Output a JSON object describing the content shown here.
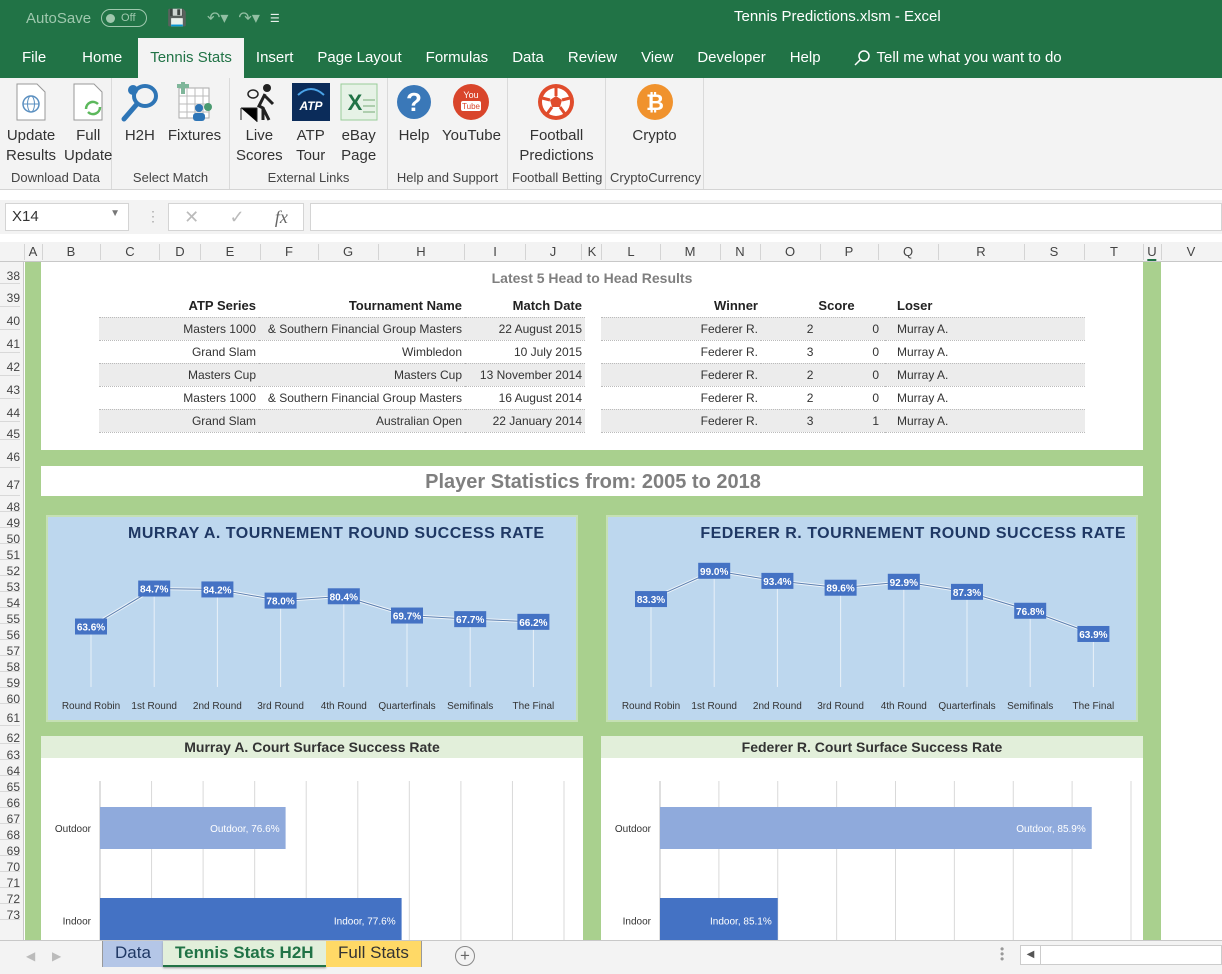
{
  "titlebar": {
    "autosave_label": "AutoSave",
    "autosave_state": "Off",
    "window_title": "Tennis Predictions.xlsm  -  Excel"
  },
  "menu_tabs": [
    "File",
    "Home",
    "Tennis Stats",
    "Insert",
    "Page Layout",
    "Formulas",
    "Data",
    "Review",
    "View",
    "Developer",
    "Help"
  ],
  "active_tab": "Tennis Stats",
  "tell_me": "Tell me what you want to do",
  "ribbon": {
    "groups": [
      {
        "label": "Download Data",
        "buttons": [
          {
            "label1": "Update",
            "label2": "Results",
            "icon": "globe-document-icon"
          },
          {
            "label1": "Full",
            "label2": "Update",
            "icon": "refresh-document-icon"
          }
        ]
      },
      {
        "label": "Select Match",
        "buttons": [
          {
            "label1": "H2H",
            "label2": "",
            "icon": "tennis-racket-icon"
          },
          {
            "label1": "Fixtures",
            "label2": "",
            "icon": "calendar-people-icon"
          }
        ]
      },
      {
        "label": "External Links",
        "buttons": [
          {
            "label1": "Live",
            "label2": "Scores",
            "icon": "tennis-player-icon"
          },
          {
            "label1": "ATP",
            "label2": "Tour",
            "icon": "atp-logo-icon"
          },
          {
            "label1": "eBay",
            "label2": "Page",
            "icon": "excel-sheet-icon"
          }
        ]
      },
      {
        "label": "Help and Support",
        "buttons": [
          {
            "label1": "Help",
            "label2": "",
            "icon": "help-icon"
          },
          {
            "label1": "YouTube",
            "label2": "",
            "icon": "youtube-icon"
          }
        ]
      },
      {
        "label": "Football Betting",
        "buttons": [
          {
            "label1": "Football",
            "label2": "Predictions",
            "icon": "football-icon"
          }
        ]
      },
      {
        "label": "CryptoCurrency",
        "buttons": [
          {
            "label1": "Crypto",
            "label2": "",
            "icon": "bitcoin-icon"
          }
        ]
      }
    ]
  },
  "formula_bar": {
    "name_box": "X14",
    "formula": ""
  },
  "columns": [
    "A",
    "B",
    "C",
    "D",
    "E",
    "F",
    "G",
    "H",
    "I",
    "J",
    "K",
    "L",
    "M",
    "N",
    "O",
    "P",
    "Q",
    "R",
    "S",
    "T",
    "U",
    "V"
  ],
  "rows": [
    "38",
    "39",
    "40",
    "41",
    "42",
    "43",
    "44",
    "45",
    "46",
    "47",
    "48",
    "49",
    "50",
    "51",
    "52",
    "53",
    "54",
    "55",
    "56",
    "57",
    "58",
    "59",
    "60",
    "61",
    "62",
    "63",
    "64",
    "65",
    "66",
    "67",
    "68",
    "69",
    "70",
    "71",
    "72",
    "73"
  ],
  "h2h": {
    "title": "Latest 5 Head to Head Results",
    "headers": {
      "series": "ATP Series",
      "tournament": "Tournament Name",
      "date": "Match Date",
      "winner": "Winner",
      "score": "Score",
      "loser": "Loser"
    },
    "rows": [
      {
        "series": "Masters 1000",
        "tournament": "& Southern Financial Group Masters",
        "date": "22 August 2015",
        "winner": "Federer R.",
        "s1": "2",
        "s2": "0",
        "loser": "Murray A."
      },
      {
        "series": "Grand Slam",
        "tournament": "Wimbledon",
        "date": "10 July 2015",
        "winner": "Federer R.",
        "s1": "3",
        "s2": "0",
        "loser": "Murray A."
      },
      {
        "series": "Masters Cup",
        "tournament": "Masters Cup",
        "date": "13 November 2014",
        "winner": "Federer R.",
        "s1": "2",
        "s2": "0",
        "loser": "Murray A."
      },
      {
        "series": "Masters 1000",
        "tournament": "& Southern Financial Group Masters",
        "date": "16 August 2014",
        "winner": "Federer R.",
        "s1": "2",
        "s2": "0",
        "loser": "Murray A."
      },
      {
        "series": "Grand Slam",
        "tournament": "Australian Open",
        "date": "22 January 2014",
        "winner": "Federer R.",
        "s1": "3",
        "s2": "1",
        "loser": "Murray A."
      }
    ]
  },
  "stats_title": "Player Statistics from: 2005 to 2018",
  "chart_data": [
    {
      "type": "line",
      "title": "MURRAY A. TOURNEMENT ROUND SUCCESS RATE",
      "categories": [
        "Round Robin",
        "1st Round",
        "2nd Round",
        "3rd Round",
        "4th Round",
        "Quarterfinals",
        "Semifinals",
        "The Final"
      ],
      "values": [
        63.6,
        84.7,
        84.2,
        78.0,
        80.4,
        69.7,
        67.7,
        66.2
      ],
      "labels": [
        "63.6%",
        "84.7%",
        "84.2%",
        "78.0%",
        "80.4%",
        "69.7%",
        "67.7%",
        "66.2%"
      ],
      "xlabel": "",
      "ylabel": "",
      "grid": false
    },
    {
      "type": "line",
      "title": "FEDERER R. TOURNEMENT ROUND SUCCESS RATE",
      "categories": [
        "Round Robin",
        "1st Round",
        "2nd Round",
        "3rd Round",
        "4th Round",
        "Quarterfinals",
        "Semifinals",
        "The Final"
      ],
      "values": [
        83.3,
        99.0,
        93.4,
        89.6,
        92.9,
        87.3,
        76.8,
        63.9
      ],
      "labels": [
        "83.3%",
        "99.0%",
        "93.4%",
        "89.6%",
        "92.9%",
        "87.3%",
        "76.8%",
        "63.9%"
      ],
      "xlabel": "",
      "ylabel": "",
      "grid": false
    },
    {
      "type": "bar",
      "orientation": "horizontal",
      "title": "Murray A. Court Surface Success Rate",
      "categories": [
        "Outdoor",
        "Indoor"
      ],
      "values": [
        76.6,
        77.6
      ],
      "labels": [
        "Outdoor, 76.6%",
        "Indoor, 77.6%"
      ],
      "xlim": [
        75,
        79
      ],
      "grid": true
    },
    {
      "type": "bar",
      "orientation": "horizontal",
      "title": "Federer R. Court Surface Success Rate",
      "categories": [
        "Outdoor",
        "Indoor"
      ],
      "values": [
        85.9,
        85.1
      ],
      "labels": [
        "Outdoor, 85.9%",
        "Indoor, 85.1%"
      ],
      "xlim": [
        84.8,
        86.0
      ],
      "grid": true
    }
  ],
  "sheet_tabs": [
    {
      "label": "Data",
      "color": "#b4c6e7"
    },
    {
      "label": "Tennis Stats H2H",
      "color": "#e2efda",
      "active": true
    },
    {
      "label": "Full Stats",
      "color": "#ffd966"
    }
  ],
  "colors": {
    "excel_green": "#217346",
    "sheet_green": "#a9d08e",
    "chart_bg": "#bdd7ee",
    "marker": "#4472c4",
    "bar_light": "#8faadc",
    "bar_dark": "#4472c4",
    "title_navy": "#1f3864"
  }
}
